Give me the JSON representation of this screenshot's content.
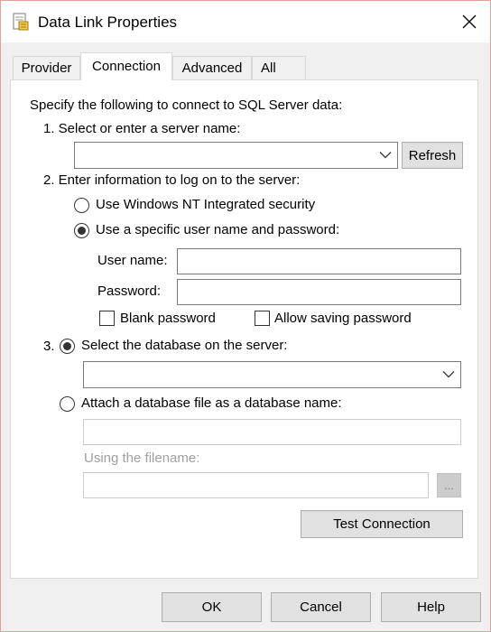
{
  "window": {
    "title": "Data Link Properties"
  },
  "tabs": [
    {
      "label": "Provider"
    },
    {
      "label": "Connection"
    },
    {
      "label": "Advanced"
    },
    {
      "label": "All"
    }
  ],
  "connection": {
    "intro": "Specify the following to connect to SQL Server data:",
    "step1": "1. Select or enter a server name:",
    "server_value": "",
    "refresh_label": "Refresh",
    "step2": "2. Enter information to log on to the server:",
    "radio_nt": "Use Windows NT Integrated security",
    "radio_specific": "Use a specific user name and password:",
    "username_label": "User name:",
    "username_value": "",
    "password_label": "Password:",
    "password_value": "",
    "blank_password": "Blank password",
    "allow_saving": "Allow saving password",
    "step3_num": "3.",
    "radio_select_db": "Select the database on the server:",
    "database_value": "",
    "radio_attach": "Attach a database file as a database name:",
    "attach_value": "",
    "using_filename": "Using the filename:",
    "filename_value": "",
    "browse_label": "...",
    "test_connection": "Test Connection"
  },
  "footer": {
    "ok": "OK",
    "cancel": "Cancel",
    "help": "Help"
  }
}
